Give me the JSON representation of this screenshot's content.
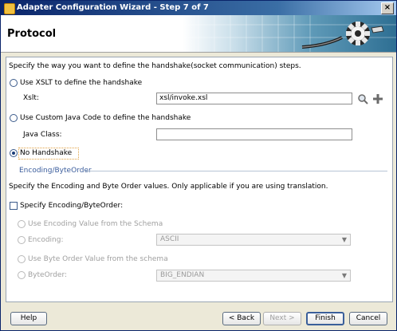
{
  "window": {
    "title": "Adapter Configuration Wizard - Step 7 of 7",
    "close_glyph": "×"
  },
  "header": {
    "title": "Protocol"
  },
  "main": {
    "intro": "Specify the way you want to define the handshake(socket communication) steps.",
    "xslt_option": {
      "label": "Use XSLT to define the handshake",
      "checked": false
    },
    "xslt_field": {
      "label": "Xslt:",
      "value": "xsl/invoke.xsl"
    },
    "java_option": {
      "label": "Use Custom Java Code to define the handshake",
      "checked": false
    },
    "java_field": {
      "label": "Java Class:",
      "value": ""
    },
    "no_handshake_option": {
      "label": "No Handshake",
      "checked": true
    },
    "encoding_section": {
      "title": "Encoding/ByteOrder",
      "description": "Specify the Encoding and Byte Order values. Only applicable if you are using translation.",
      "specify_checkbox": {
        "label": "Specify Encoding/ByteOrder:",
        "checked": false
      },
      "use_encoding_schema": {
        "label": "Use Encoding Value from the Schema"
      },
      "encoding": {
        "label": "Encoding:",
        "selected": "ASCII"
      },
      "use_byteorder_schema": {
        "label": "Use Byte Order Value from the schema"
      },
      "byteorder": {
        "label": "ByteOrder:",
        "selected": "BIG_ENDIAN"
      }
    }
  },
  "footer": {
    "help": "Help",
    "back": "< Back",
    "next": "Next >",
    "finish": "Finish",
    "cancel": "Cancel"
  },
  "colors": {
    "title_bar": "#0a246a",
    "section_label": "#3b5d9c",
    "selected_radio": "#1c3e78"
  },
  "icons": [
    "gear-connector-icon",
    "search-icon",
    "add-icon",
    "chevron-down-icon",
    "close-icon"
  ]
}
